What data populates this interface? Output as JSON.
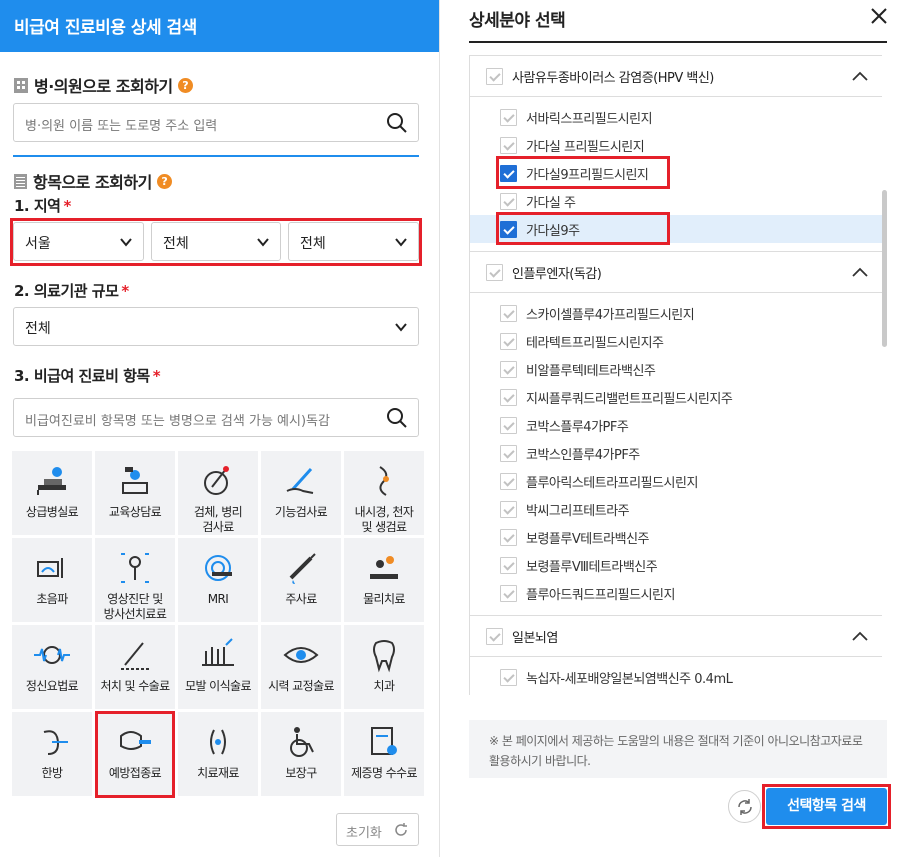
{
  "left": {
    "title": "비급여 진료비용 상세 검색",
    "hospital_section": {
      "title": "병·의원으로 조회하기",
      "help": "?",
      "placeholder": "병·의원 이름 또는 도로명 주소 입력"
    },
    "item_section": {
      "title": "항목으로 조회하기",
      "help": "?"
    },
    "region": {
      "label": "1. 지역",
      "required": "*",
      "selects": [
        "서울",
        "전체",
        "전체"
      ]
    },
    "size": {
      "label": "2. 의료기관 규모",
      "required": "*",
      "value": "전체"
    },
    "items": {
      "label": "3. 비급여 진료비 항목",
      "required": "*",
      "placeholder": "비급여진료비 항목명 또는 병명으로 검색 가능 예시)독감"
    },
    "categories": [
      {
        "label": "상급병실료",
        "icon": "hospital-bed-icon"
      },
      {
        "label": "교육상담료",
        "icon": "counseling-icon"
      },
      {
        "label": "검체, 병리\n검사료",
        "icon": "microscope-icon"
      },
      {
        "label": "기능검사료",
        "icon": "pen-hand-icon"
      },
      {
        "label": "내시경, 천자\n및 생검료",
        "icon": "endoscope-icon"
      },
      {
        "label": "초음파",
        "icon": "ultrasound-icon"
      },
      {
        "label": "영상진단 및\n방사선치료료",
        "icon": "xray-icon"
      },
      {
        "label": "MRI",
        "icon": "mri-icon"
      },
      {
        "label": "주사료",
        "icon": "syringe-icon"
      },
      {
        "label": "물리치료",
        "icon": "physical-therapy-icon"
      },
      {
        "label": "정신요법료",
        "icon": "brain-wave-icon"
      },
      {
        "label": "처치 및 수술료",
        "icon": "surgery-icon"
      },
      {
        "label": "모발 이식술료",
        "icon": "hair-icon"
      },
      {
        "label": "시력 교정술료",
        "icon": "eye-icon"
      },
      {
        "label": "치과",
        "icon": "tooth-icon"
      },
      {
        "label": "한방",
        "icon": "acupuncture-icon"
      },
      {
        "label": "예방접종료",
        "icon": "vaccine-icon"
      },
      {
        "label": "치료재료",
        "icon": "lens-icon"
      },
      {
        "label": "보장구",
        "icon": "wheelchair-icon"
      },
      {
        "label": "제증명 수수료",
        "icon": "certificate-icon"
      }
    ],
    "reset": "초기화"
  },
  "right": {
    "title": "상세분야 선택",
    "groups": [
      {
        "label": "사람유두종바이러스 감염증(HPV 백신)",
        "items": [
          {
            "label": "서바릭스프리필드시린지",
            "checked": false
          },
          {
            "label": "가다실 프리필드시린지",
            "checked": false
          },
          {
            "label": "가다실9프리필드시린지",
            "checked": true
          },
          {
            "label": "가다실 주",
            "checked": false
          },
          {
            "label": "가다실9주",
            "checked": true
          }
        ]
      },
      {
        "label": "인플루엔자(독감)",
        "items": [
          {
            "label": "스카이셀플루4가프리필드시린지",
            "checked": false
          },
          {
            "label": "테라텍트프리필드시린지주",
            "checked": false
          },
          {
            "label": "비알플루텍I테트라백신주",
            "checked": false
          },
          {
            "label": "지씨플루쿼드리밸런트프리필드시린지주",
            "checked": false
          },
          {
            "label": "코박스플루4가PF주",
            "checked": false
          },
          {
            "label": "코박스인플루4가PF주",
            "checked": false
          },
          {
            "label": "플루아릭스테트라프리필드시린지",
            "checked": false
          },
          {
            "label": "박씨그리프테트라주",
            "checked": false
          },
          {
            "label": "보령플루Ⅴ테트라백신주",
            "checked": false
          },
          {
            "label": "보령플루Ⅷ테트라백신주",
            "checked": false
          },
          {
            "label": "플루아드쿼드프리필드시린지",
            "checked": false
          }
        ]
      },
      {
        "label": "일본뇌염",
        "items": [
          {
            "label": "녹십자-세포배양일본뇌염백신주 0.4mL",
            "checked": false
          }
        ]
      }
    ],
    "notice": "※ 본 페이지에서 제공하는 도움말의 내용은 절대적 기준이 아니오니참고자료로 활용하시기 바랍니다.",
    "submit": "선택항목 검색"
  },
  "colors": {
    "primary": "#1f8ded",
    "highlight": "#e5202a",
    "help": "#f08c24"
  }
}
